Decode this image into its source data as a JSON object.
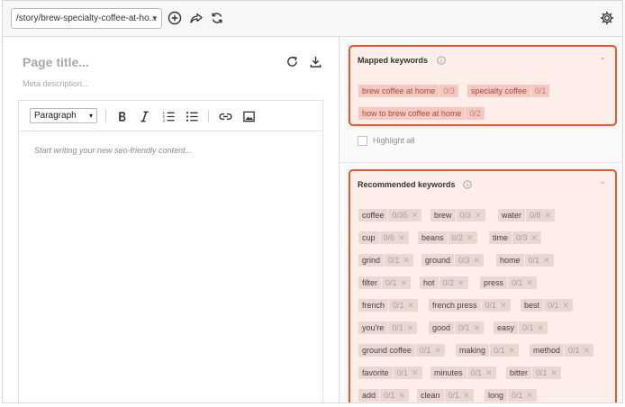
{
  "toolbar": {
    "url_value": "/story/brew-specialty-coffee-at-ho...",
    "icons": [
      "add-circle-icon",
      "share-icon",
      "refresh-icon",
      "gear-icon"
    ]
  },
  "editor": {
    "title_placeholder": "Page title...",
    "meta_placeholder": "Meta description...",
    "paragraph_style": "Paragraph",
    "content_placeholder": "Start writing your new seo-friendly content..."
  },
  "mapped": {
    "title": "Mapped keywords",
    "keywords": [
      {
        "keyword": "brew coffee at home",
        "count": "0/3"
      },
      {
        "keyword": "specialty coffee",
        "count": "0/1"
      },
      {
        "keyword": "how to brew coffee at home",
        "count": "0/2"
      }
    ],
    "highlight_label": "Highlight all"
  },
  "recommended": {
    "title": "Recommended keywords",
    "keywords": [
      {
        "keyword": "coffee",
        "count": "0/35"
      },
      {
        "keyword": "brew",
        "count": "0/3"
      },
      {
        "keyword": "water",
        "count": "0/8"
      },
      {
        "keyword": "cup",
        "count": "0/6"
      },
      {
        "keyword": "beans",
        "count": "0/2"
      },
      {
        "keyword": "time",
        "count": "0/3"
      },
      {
        "keyword": "grind",
        "count": "0/1"
      },
      {
        "keyword": "ground",
        "count": "0/3"
      },
      {
        "keyword": "home",
        "count": "0/1"
      },
      {
        "keyword": "filter",
        "count": "0/1"
      },
      {
        "keyword": "hot",
        "count": "0/2"
      },
      {
        "keyword": "press",
        "count": "0/1"
      },
      {
        "keyword": "french",
        "count": "0/1"
      },
      {
        "keyword": "french press",
        "count": "0/1"
      },
      {
        "keyword": "best",
        "count": "0/1"
      },
      {
        "keyword": "you're",
        "count": "0/1"
      },
      {
        "keyword": "good",
        "count": "0/1"
      },
      {
        "keyword": "easy",
        "count": "0/1"
      },
      {
        "keyword": "ground coffee",
        "count": "0/1"
      },
      {
        "keyword": "making",
        "count": "0/1"
      },
      {
        "keyword": "method",
        "count": "0/1"
      },
      {
        "keyword": "favorite",
        "count": "0/1"
      },
      {
        "keyword": "minutes",
        "count": "0/1"
      },
      {
        "keyword": "bitter",
        "count": "0/1"
      },
      {
        "keyword": "add",
        "count": "0/1"
      },
      {
        "keyword": "clean",
        "count": "0/1"
      },
      {
        "keyword": "long",
        "count": "0/1"
      }
    ]
  },
  "colors": {
    "accent_border": "#e35a2b",
    "card_bg": "#fdeeea",
    "mapped_chip": "#f5c9c1",
    "recommended_chip": "#ead7d2"
  }
}
